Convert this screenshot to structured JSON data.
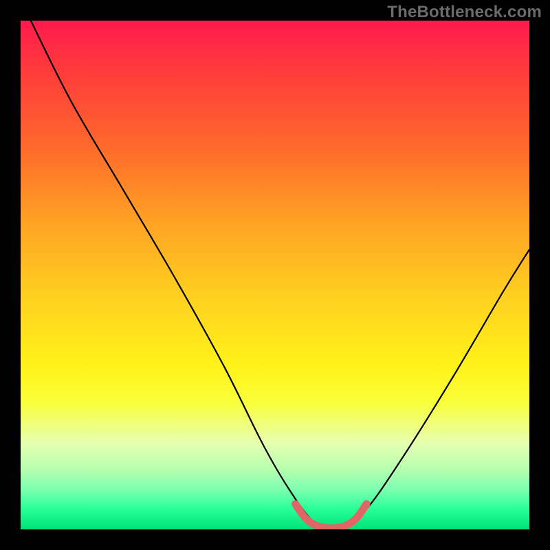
{
  "watermark": "TheBottleneck.com",
  "chart_data": {
    "type": "line",
    "title": "",
    "xlabel": "",
    "ylabel": "",
    "xlim": [
      0,
      100
    ],
    "ylim": [
      0,
      100
    ],
    "series": [
      {
        "name": "bottleneck-curve",
        "x": [
          2,
          10,
          20,
          30,
          40,
          48,
          54,
          58,
          60,
          62,
          64,
          68,
          75,
          85,
          95,
          100
        ],
        "values": [
          100,
          84,
          67,
          50,
          32,
          16,
          6,
          1,
          0,
          0,
          1,
          4,
          14,
          30,
          47,
          55
        ]
      }
    ],
    "highlight": {
      "name": "optimal-range",
      "x": [
        54,
        56,
        58,
        60,
        62,
        64,
        66,
        68
      ],
      "values": [
        5,
        2.2,
        0.8,
        0.3,
        0.3,
        0.8,
        2.2,
        5
      ]
    },
    "colors": {
      "curve": "#000000",
      "highlight": "#e06666",
      "gradient_top": "#ff1a4d",
      "gradient_bottom": "#00e27a"
    }
  }
}
